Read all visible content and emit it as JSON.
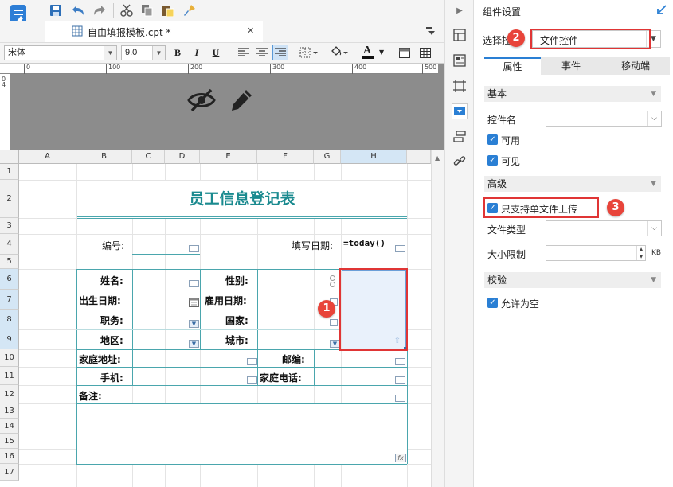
{
  "colors": {
    "accent": "#2a7fd4",
    "teal": "#1a8a8f",
    "highlight": "#e03535"
  },
  "toolbar": {
    "icons": [
      "save-icon",
      "undo-icon",
      "redo-icon",
      "cut-icon",
      "copy-icon",
      "paste-icon",
      "format-brush-icon"
    ]
  },
  "doc_tab": {
    "title": "自由填报模板.cpt *",
    "close": "✕"
  },
  "format": {
    "font_name": "宋体",
    "font_size": "9.0",
    "bold": "B",
    "italic": "I",
    "underline": "U",
    "font_color_letter": "A"
  },
  "ruler": {
    "ticks": [
      "0",
      "100",
      "200",
      "300",
      "400",
      "500"
    ],
    "vticks": [
      "0",
      "4"
    ]
  },
  "sheet": {
    "columns": [
      "A",
      "B",
      "C",
      "D",
      "E",
      "F",
      "G",
      "H"
    ],
    "rows": [
      "1",
      "2",
      "3",
      "4",
      "5",
      "6",
      "7",
      "8",
      "9",
      "10",
      "11",
      "12",
      "13",
      "14",
      "15",
      "16",
      "17"
    ],
    "title": "员工信息登记表",
    "labels": {
      "number": "编号:",
      "fill_date": "填写日期:",
      "today_formula": "=today()",
      "name": "姓名:",
      "gender": "性别:",
      "birth_date": "出生日期:",
      "hire_date": "雇用日期:",
      "position": "职务:",
      "country": "国家:",
      "region": "地区:",
      "city": "城市:",
      "home_address": "家庭地址:",
      "postcode": "邮编:",
      "mobile": "手机:",
      "home_phone": "家庭电话:",
      "remarks": "备注:",
      "fx": "fx"
    }
  },
  "badges": {
    "one": "1",
    "two": "2",
    "three": "3"
  },
  "panel": {
    "title": "组件设置",
    "select_label": "选择控件",
    "select_value": "文件控件",
    "tabs": [
      "属性",
      "事件",
      "移动端"
    ],
    "section_basic": "基本",
    "widget_name_label": "控件名",
    "enabled_label": "可用",
    "visible_label": "可见",
    "section_advanced": "高级",
    "single_upload_label": "只支持单文件上传",
    "file_type_label": "文件类型",
    "size_limit_label": "大小限制",
    "size_unit": "KB",
    "section_validation": "校验",
    "allow_empty_label": "允许为空"
  }
}
